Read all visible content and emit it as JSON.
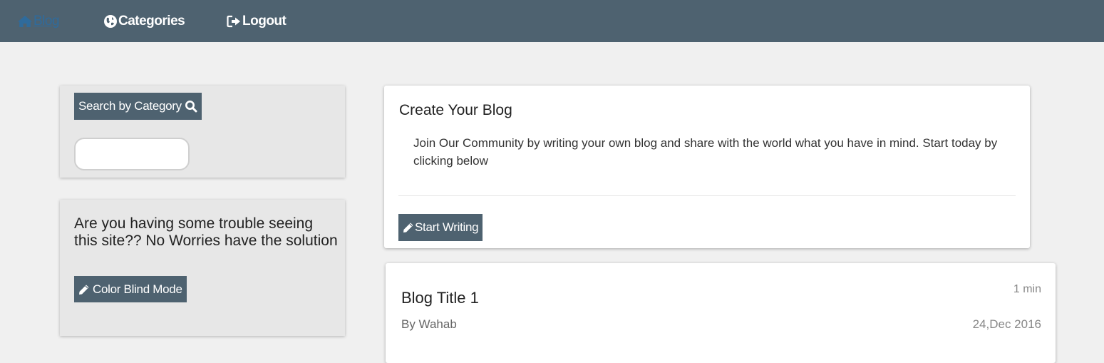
{
  "nav": {
    "blog": "Blog",
    "categories": "Categories",
    "logout": "Logout"
  },
  "search": {
    "button_label": "Search by Category",
    "placeholder": ""
  },
  "help": {
    "text": "Are you having some trouble seeing this site?? No Worries have the solution",
    "button_label": "Color Blind Mode"
  },
  "create": {
    "title": "Create Your Blog",
    "description": "Join Our Community by writing your own blog and share with the world what you have in mind. Start today by clicking below",
    "button_label": "Start Writing"
  },
  "posts": [
    {
      "title": "Blog Title 1",
      "author": "By Wahab",
      "read_time": "1 min",
      "date": "24,Dec 2016"
    }
  ],
  "colors": {
    "navbar": "#4e6270",
    "background": "#f0f0f0",
    "active_link": "#2f6b9c"
  }
}
